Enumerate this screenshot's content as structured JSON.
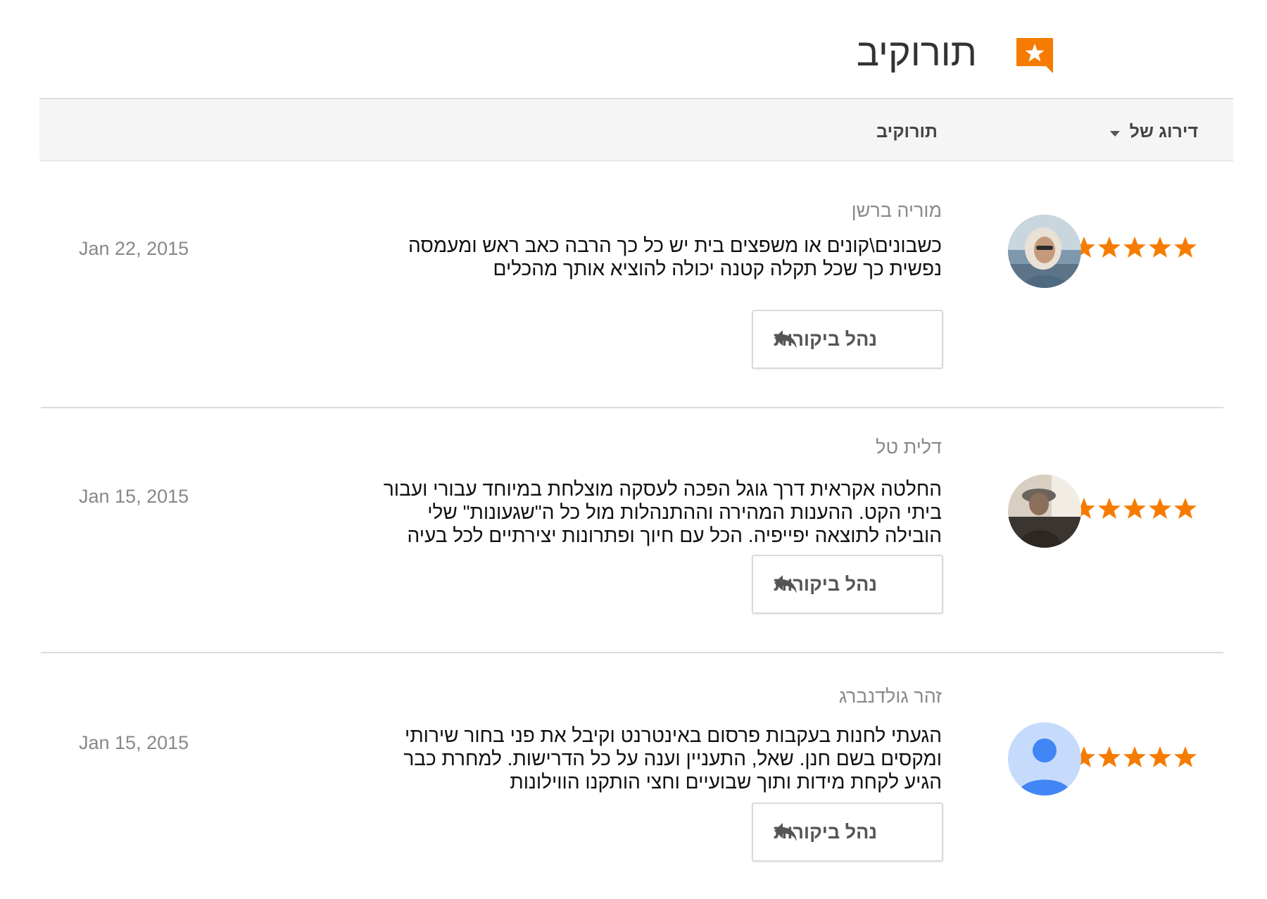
{
  "header": {
    "title": "תורוקיב",
    "icon": "review-star-icon",
    "accent_color": "#f57c00"
  },
  "columns": {
    "sort_label": "דירוג של",
    "reviews_label": "תורוקיב"
  },
  "reviews": [
    {
      "reviewer": "מוריה ברשן",
      "rating": 5,
      "comment": "כשבונים\\קונים או משפצים בית יש כל כך הרבה כאב ראש ומעמסה נפשית כך שכל תקלה קטנה יכולה להוציא אותך מהכלים",
      "date": "Jan 22, 2015",
      "reply_label": "נהל ביקורות",
      "avatar": "photo-woman"
    },
    {
      "reviewer": "דלית טל",
      "rating": 5,
      "comment": "החלטה אקראית דרך גוגל הפכה לעסקה מוצלחת במיוחד עבורי ועבור ביתי הקט. ההענות המהירה וההתנהלות מול כל ה\"שגעונות\" שלי הובילה לתוצאה יפייפיה. הכל עם חיוך ופתרונות יצירתיים לכל בעיה",
      "date": "Jan 15, 2015",
      "reply_label": "נהל ביקורות",
      "avatar": "photo-person-hat"
    },
    {
      "reviewer": "זהר גולדנברג",
      "rating": 5,
      "comment": "הגעתי לחנות בעקבות פרסום באינטרנט וקיבל את פני בחור שירותי ומקסים בשם חנן. שאל, התעניין וענה על כל הדרישות. למחרת כבר הגיע לקחת מידות ותוך שבועיים וחצי הותקנו הווילונות",
      "date": "Jan 15, 2015",
      "reply_label": "נהל ביקורות",
      "avatar": "default-user"
    }
  ],
  "colors": {
    "star": "#f57c00",
    "divider": "#dcdcdc",
    "header_bg": "#f5f5f5"
  }
}
